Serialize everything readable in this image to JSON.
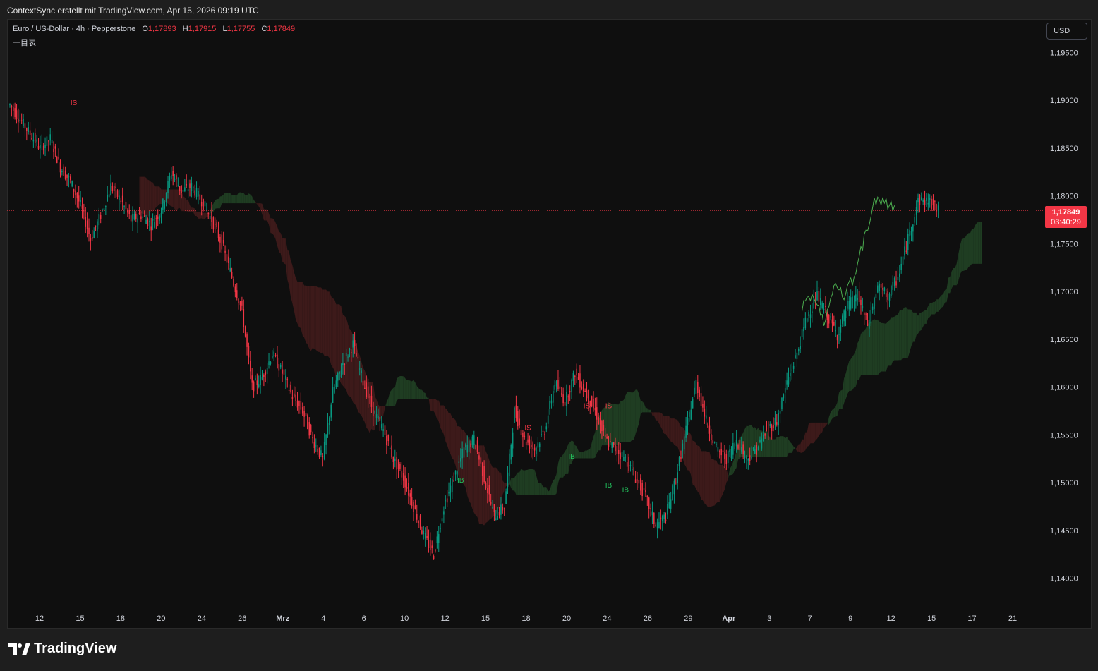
{
  "caption": "ContextSync erstellt mit TradingView.com, Apr 15, 2026 09:19 UTC",
  "legend": {
    "symbol": "Euro / US-Dollar · 4h · Pepperstone",
    "o_label": "O",
    "o_value": "1,17893",
    "h_label": "H",
    "h_value": "1,17915",
    "l_label": "L",
    "l_value": "1,17755",
    "c_label": "C",
    "c_value": "1,17849",
    "indicator": "一目表"
  },
  "currency_button": "USD",
  "last_price": {
    "value": "1,17849",
    "countdown": "03:40:29"
  },
  "brand": "TradingView",
  "colors": {
    "up": "#089981",
    "down": "#f23645",
    "bg": "#0f0f0f",
    "kumo_bull": "#1f3d22",
    "kumo_bear": "#3d1a1a"
  },
  "chart_data": {
    "type": "candlestick",
    "x_ticks": [
      "12",
      "15",
      "18",
      "20",
      "24",
      "26",
      "Mrz",
      "4",
      "6",
      "10",
      "12",
      "15",
      "18",
      "20",
      "24",
      "26",
      "29",
      "Apr",
      "3",
      "7",
      "9",
      "12",
      "15",
      "17",
      "21"
    ],
    "y_ticks": [
      "1,19500",
      "1,19000",
      "1,18500",
      "1,18000",
      "1,17500",
      "1,17000",
      "1,16500",
      "1,16000",
      "1,15500",
      "1,15000",
      "1,14500",
      "1,14000"
    ],
    "y_tick_values": [
      1.195,
      1.19,
      1.185,
      1.18,
      1.175,
      1.17,
      1.165,
      1.16,
      1.155,
      1.15,
      1.145,
      1.14
    ],
    "ylim": [
      1.1365,
      1.1985
    ],
    "current_price": 1.17849,
    "close_path": [
      [
        0,
        1.1895
      ],
      [
        6,
        1.188
      ],
      [
        12,
        1.1865
      ],
      [
        18,
        1.185
      ],
      [
        24,
        1.186
      ],
      [
        30,
        1.183
      ],
      [
        36,
        1.1815
      ],
      [
        42,
        1.179
      ],
      [
        48,
        1.1755
      ],
      [
        54,
        1.178
      ],
      [
        60,
        1.181
      ],
      [
        66,
        1.1795
      ],
      [
        72,
        1.1775
      ],
      [
        78,
        1.178
      ],
      [
        84,
        1.177
      ],
      [
        90,
        1.1785
      ],
      [
        96,
        1.1825
      ],
      [
        102,
        1.1805
      ],
      [
        108,
        1.181
      ],
      [
        114,
        1.1795
      ],
      [
        120,
        1.1775
      ],
      [
        126,
        1.175
      ],
      [
        132,
        1.1715
      ],
      [
        138,
        1.168
      ],
      [
        144,
        1.16
      ],
      [
        150,
        1.161
      ],
      [
        156,
        1.1635
      ],
      [
        162,
        1.1615
      ],
      [
        168,
        1.159
      ],
      [
        174,
        1.1575
      ],
      [
        180,
        1.1545
      ],
      [
        186,
        1.1525
      ],
      [
        192,
        1.1595
      ],
      [
        198,
        1.1625
      ],
      [
        204,
        1.1645
      ],
      [
        210,
        1.1605
      ],
      [
        216,
        1.1575
      ],
      [
        222,
        1.1555
      ],
      [
        228,
        1.1525
      ],
      [
        234,
        1.1505
      ],
      [
        240,
        1.1475
      ],
      [
        246,
        1.1445
      ],
      [
        252,
        1.1425
      ],
      [
        258,
        1.1475
      ],
      [
        264,
        1.1505
      ],
      [
        270,
        1.1535
      ],
      [
        276,
        1.1545
      ],
      [
        282,
        1.1505
      ],
      [
        288,
        1.1465
      ],
      [
        294,
        1.1475
      ],
      [
        300,
        1.1575
      ],
      [
        306,
        1.1545
      ],
      [
        312,
        1.1535
      ],
      [
        318,
        1.1555
      ],
      [
        324,
        1.1605
      ],
      [
        330,
        1.1585
      ],
      [
        336,
        1.1615
      ],
      [
        342,
        1.1595
      ],
      [
        348,
        1.1575
      ],
      [
        354,
        1.1545
      ],
      [
        360,
        1.1535
      ],
      [
        366,
        1.1525
      ],
      [
        372,
        1.1505
      ],
      [
        378,
        1.1485
      ],
      [
        384,
        1.1455
      ],
      [
        390,
        1.1465
      ],
      [
        396,
        1.1505
      ],
      [
        402,
        1.1555
      ],
      [
        408,
        1.1605
      ],
      [
        414,
        1.1565
      ],
      [
        420,
        1.1535
      ],
      [
        426,
        1.1525
      ],
      [
        432,
        1.1545
      ],
      [
        438,
        1.1525
      ],
      [
        444,
        1.1535
      ],
      [
        450,
        1.1555
      ],
      [
        456,
        1.1565
      ],
      [
        462,
        1.1605
      ],
      [
        468,
        1.1635
      ],
      [
        474,
        1.1675
      ],
      [
        480,
        1.1695
      ],
      [
        486,
        1.1675
      ],
      [
        492,
        1.1655
      ],
      [
        498,
        1.1685
      ],
      [
        504,
        1.1695
      ],
      [
        510,
        1.1665
      ],
      [
        516,
        1.1705
      ],
      [
        522,
        1.1695
      ],
      [
        528,
        1.1715
      ],
      [
        534,
        1.1755
      ],
      [
        540,
        1.1795
      ],
      [
        546,
        1.1795
      ],
      [
        552,
        1.1785
      ]
    ],
    "annotations": [
      {
        "text": "IS",
        "x": 38,
        "price": 1.1895,
        "color": "#f23645"
      },
      {
        "text": "IS",
        "x": 308,
        "price": 1.1555,
        "color": "#f23645"
      },
      {
        "text": "IS",
        "x": 343,
        "price": 1.1578,
        "color": "#f23645"
      },
      {
        "text": "IS",
        "x": 356,
        "price": 1.1578,
        "color": "#f23645"
      },
      {
        "text": "IB",
        "x": 268,
        "price": 1.15,
        "color": "#22c55e"
      },
      {
        "text": "IB",
        "x": 334,
        "price": 1.1525,
        "color": "#22c55e"
      },
      {
        "text": "IB",
        "x": 356,
        "price": 1.1495,
        "color": "#22c55e"
      },
      {
        "text": "IB",
        "x": 366,
        "price": 1.149,
        "color": "#22c55e"
      }
    ],
    "grid": false
  }
}
